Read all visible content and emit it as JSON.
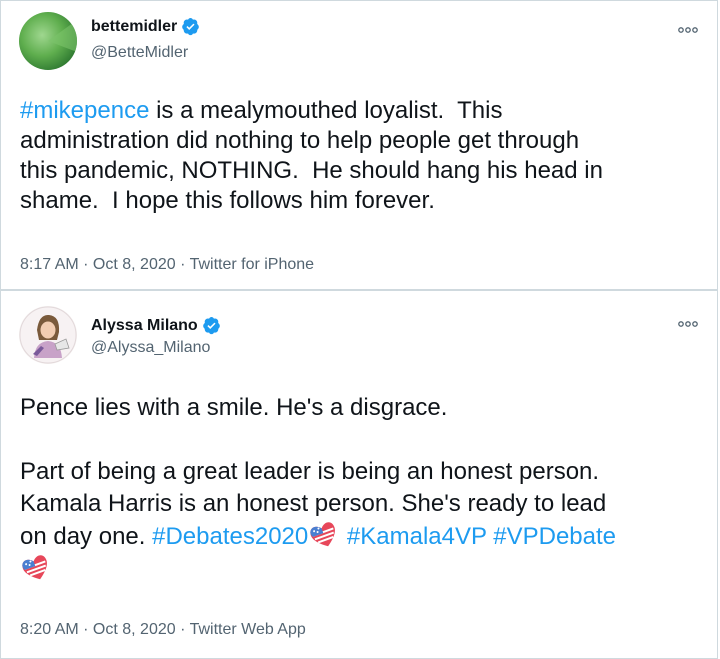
{
  "tweets": [
    {
      "display_name": "bettemidler",
      "handle": "@BetteMidler",
      "hashtag": "#mikepence",
      "text_lines": [
        " is a mealymouthed loyalist.  This",
        "administration did nothing to help people get through",
        "this pandemic, NOTHING.  He should hang his head in",
        "shame.  I hope this follows him forever."
      ],
      "timestamp": "8:17 AM · Oct 8, 2020 · Twitter for iPhone",
      "verified": true
    },
    {
      "display_name": "Alyssa Milano",
      "handle": "@Alyssa_Milano",
      "line1": "Pence lies with a smile. He's a disgrace.",
      "line2": "Part of being a great leader is being an honest person.",
      "line3": "Kamala Harris is an honest person. She's ready to lead",
      "line4_prefix": "on day one. ",
      "hashtags": [
        "#Debates2020",
        "#Kamala4VP",
        "#VPDebate"
      ],
      "timestamp": "8:20 AM · Oct 8, 2020 · Twitter Web App",
      "verified": true
    }
  ],
  "colors": {
    "link": "#1d9bf0",
    "text": "#0f1419",
    "secondary": "#536471",
    "verified": "#1d9bf0",
    "border": "#cfd9de"
  },
  "icons": {
    "verified": "verified-badge-icon",
    "more": "more-options-icon",
    "emoji": "heart-flag-emoji-icon"
  }
}
